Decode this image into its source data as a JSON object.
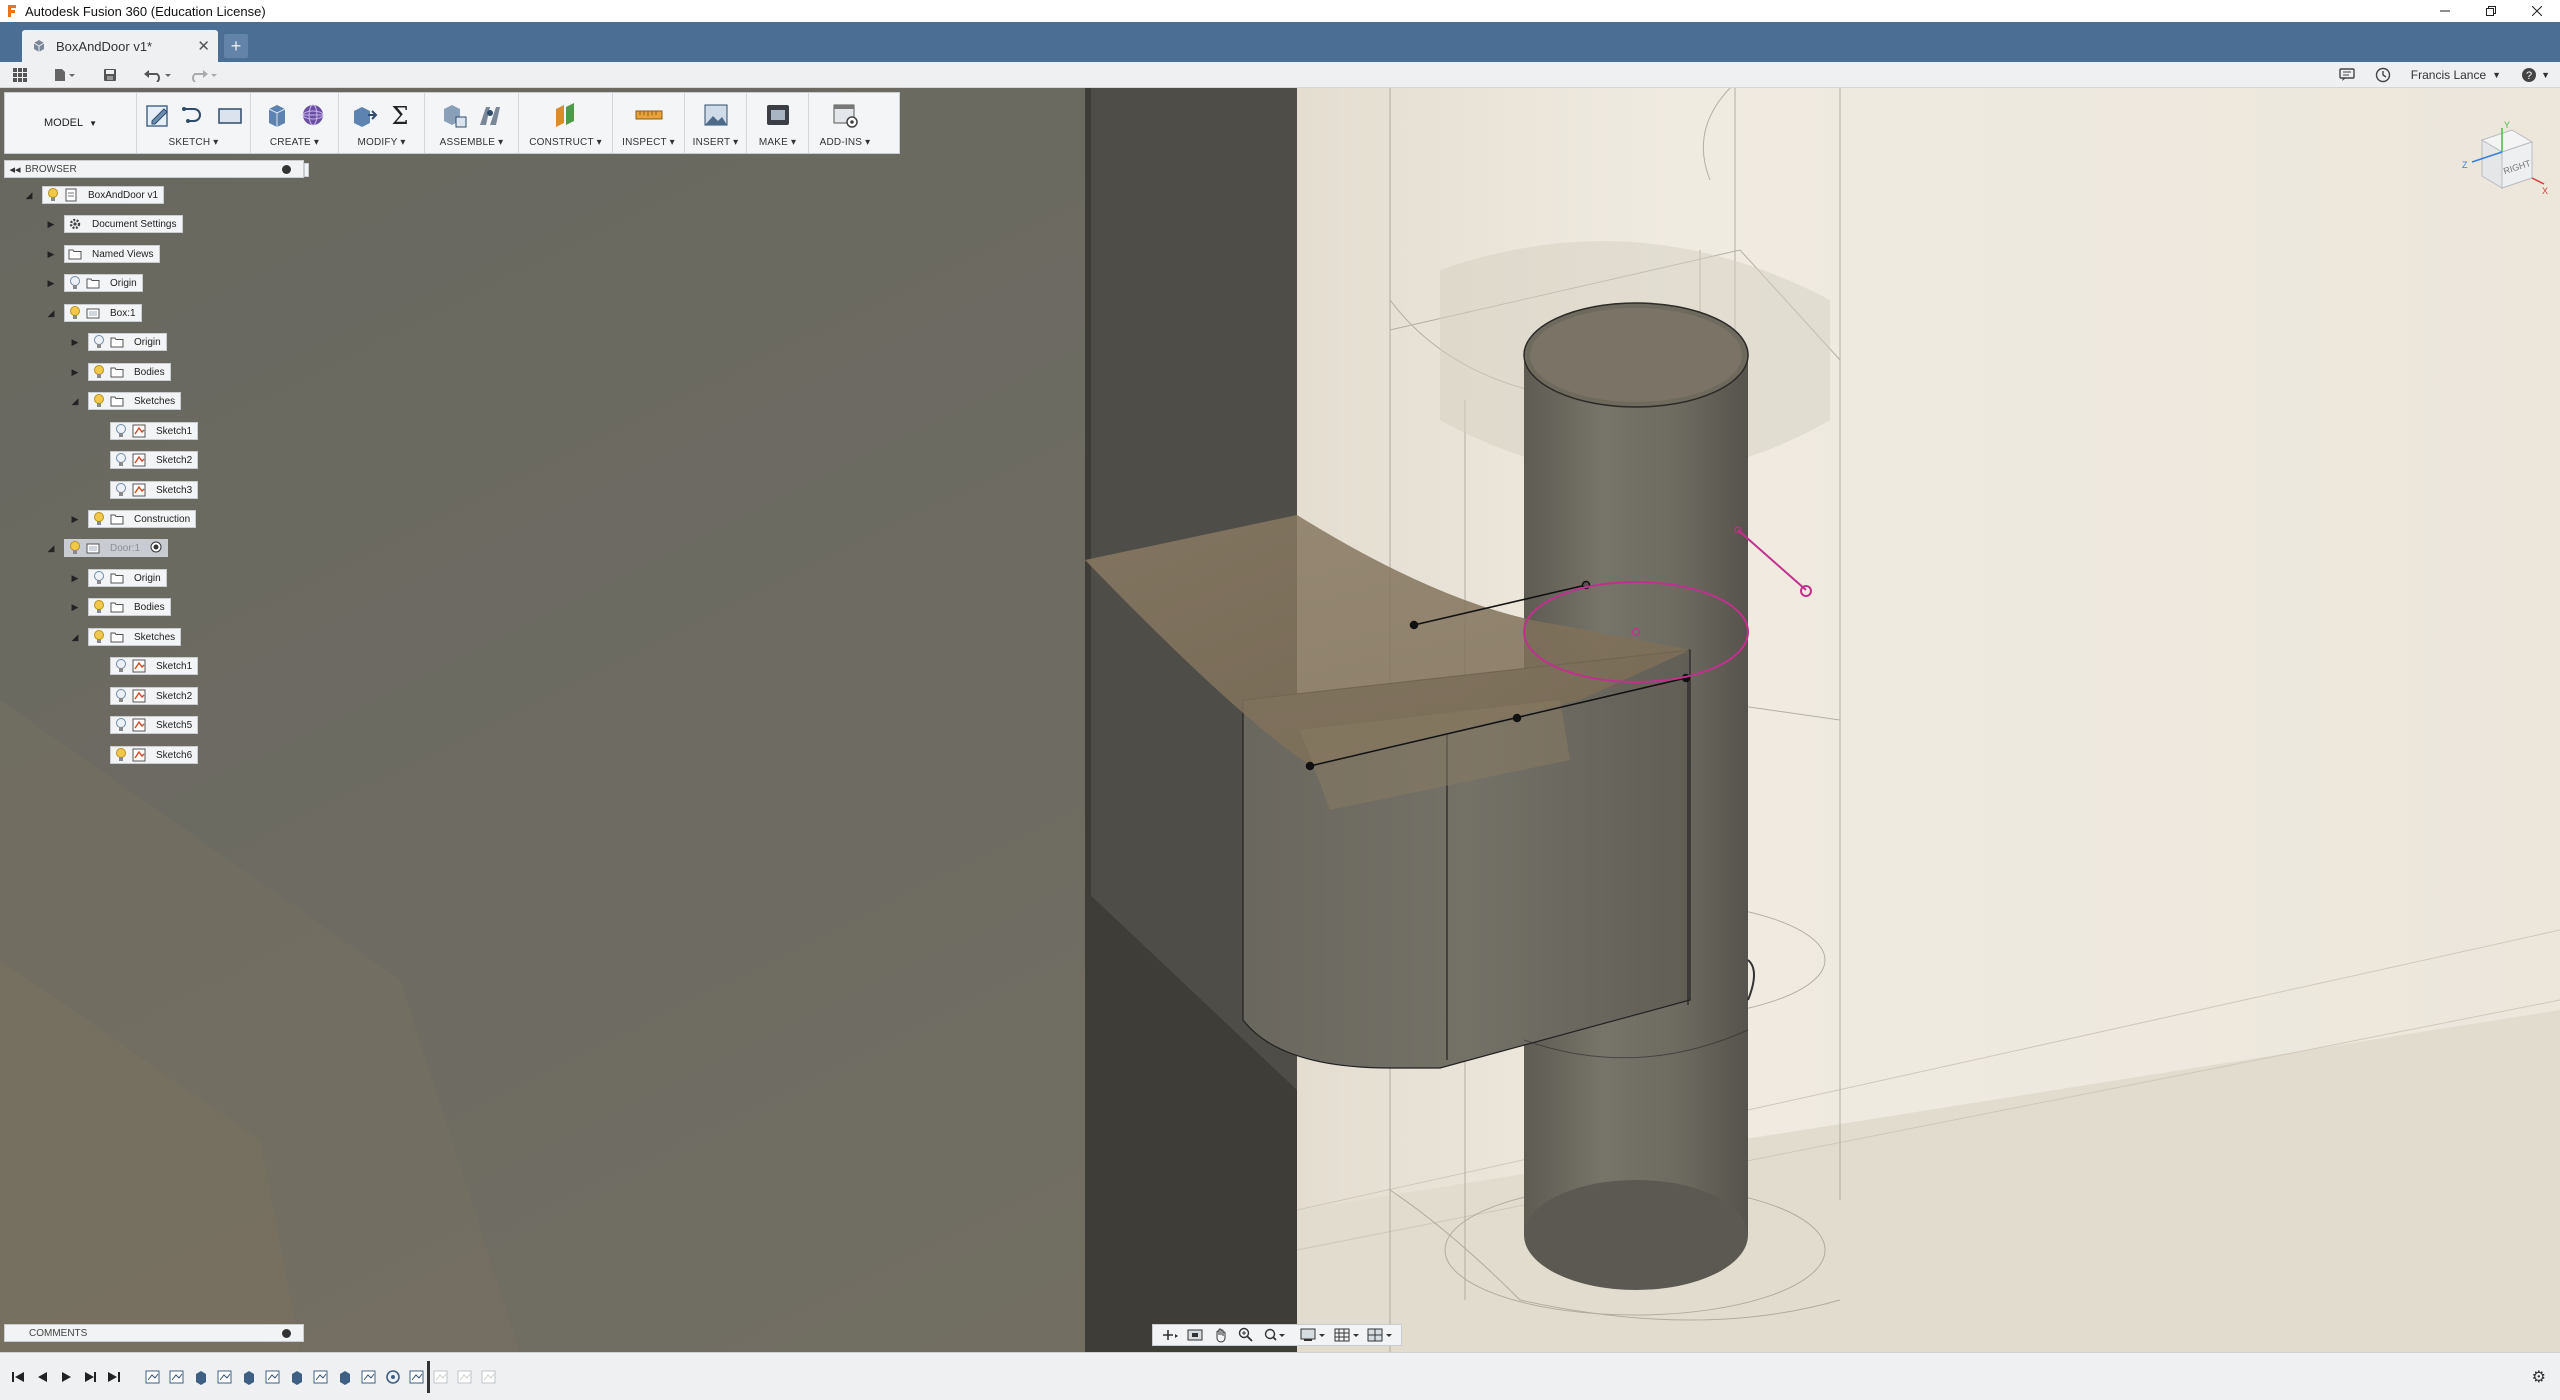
{
  "window": {
    "title": "Autodesk Fusion 360 (Education License)",
    "controls": [
      "minimize-icon",
      "restore-icon",
      "close-icon"
    ]
  },
  "tabs": {
    "active_label": "BoxAndDoor v1*",
    "new_tab_symbol": "+"
  },
  "quick_access": {
    "user_name": "Francis Lance",
    "help_symbol": "?"
  },
  "ribbon": {
    "mode": "MODEL",
    "groups": [
      {
        "label": "SKETCH",
        "icons": [
          "create-sketch-icon",
          "line-icon",
          "rectangle-icon"
        ]
      },
      {
        "label": "CREATE",
        "icons": [
          "extrude-icon",
          "form-icon"
        ]
      },
      {
        "label": "MODIFY",
        "icons": [
          "press-pull-icon",
          "parameters-icon"
        ]
      },
      {
        "label": "ASSEMBLE",
        "icons": [
          "new-component-icon",
          "joint-icon"
        ]
      },
      {
        "label": "CONSTRUCT",
        "icons": [
          "offset-plane-icon"
        ]
      },
      {
        "label": "INSPECT",
        "icons": [
          "measure-icon"
        ]
      },
      {
        "label": "INSERT",
        "icons": [
          "insert-image-icon"
        ]
      },
      {
        "label": "MAKE",
        "icons": [
          "3d-print-icon"
        ]
      },
      {
        "label": "ADD-INS",
        "icons": [
          "scripts-icon"
        ]
      }
    ],
    "dropdown_symbol": "▾"
  },
  "browser": {
    "title": "BROWSER",
    "items": [
      {
        "label": "BoxAndDoor v1",
        "level": 0,
        "toggle": "◢",
        "icons": [
          "bulb-icon",
          "document-icon"
        ]
      },
      {
        "label": "Document Settings",
        "level": 1,
        "toggle": "▶",
        "icons": [
          "gear-icon"
        ]
      },
      {
        "label": "Named Views",
        "level": 1,
        "toggle": "▶",
        "icons": [
          "folder-icon"
        ]
      },
      {
        "label": "Origin",
        "level": 1,
        "toggle": "▶",
        "icons": [
          "bulb-off-icon",
          "folder-icon"
        ]
      },
      {
        "label": "Box:1",
        "level": 1,
        "toggle": "◢",
        "icons": [
          "bulb-icon",
          "component-icon"
        ]
      },
      {
        "label": "Origin",
        "level": 2,
        "toggle": "▶",
        "icons": [
          "bulb-off-icon",
          "folder-icon"
        ]
      },
      {
        "label": "Bodies",
        "level": 2,
        "toggle": "▶",
        "icons": [
          "bulb-icon",
          "folder-icon"
        ]
      },
      {
        "label": "Sketches",
        "level": 2,
        "toggle": "◢",
        "icons": [
          "bulb-icon",
          "folder-icon"
        ]
      },
      {
        "label": "Sketch1",
        "level": 3,
        "toggle": "",
        "icons": [
          "bulb-off-icon",
          "sketch-icon"
        ]
      },
      {
        "label": "Sketch2",
        "level": 3,
        "toggle": "",
        "icons": [
          "bulb-off-icon",
          "sketch-icon"
        ]
      },
      {
        "label": "Sketch3",
        "level": 3,
        "toggle": "",
        "icons": [
          "bulb-off-icon",
          "sketch-icon"
        ]
      },
      {
        "label": "Construction",
        "level": 2,
        "toggle": "▶",
        "icons": [
          "bulb-icon",
          "folder-icon"
        ]
      },
      {
        "label": "Door:1",
        "level": 1,
        "toggle": "◢",
        "icons": [
          "bulb-icon",
          "component-icon"
        ],
        "active": true
      },
      {
        "label": "Origin",
        "level": 2,
        "toggle": "▶",
        "icons": [
          "bulb-off-icon",
          "folder-icon"
        ]
      },
      {
        "label": "Bodies",
        "level": 2,
        "toggle": "▶",
        "icons": [
          "bulb-icon",
          "folder-icon"
        ]
      },
      {
        "label": "Sketches",
        "level": 2,
        "toggle": "◢",
        "icons": [
          "bulb-icon",
          "folder-icon"
        ]
      },
      {
        "label": "Sketch1",
        "level": 3,
        "toggle": "",
        "icons": [
          "bulb-off-icon",
          "sketch-icon"
        ]
      },
      {
        "label": "Sketch2",
        "level": 3,
        "toggle": "",
        "icons": [
          "bulb-off-icon",
          "sketch-icon"
        ]
      },
      {
        "label": "Sketch5",
        "level": 3,
        "toggle": "",
        "icons": [
          "bulb-off-icon",
          "sketch-icon"
        ]
      },
      {
        "label": "Sketch6",
        "level": 3,
        "toggle": "",
        "icons": [
          "bulb-icon",
          "sketch-icon"
        ]
      }
    ]
  },
  "comments": {
    "title": "COMMENTS"
  },
  "viewcube": {
    "face_label": "RIGHT",
    "axis_x": "X",
    "axis_y": "Y",
    "axis_z": "Z"
  },
  "colors": {
    "tabbar": "#4a6e94",
    "panel": "#f2f3f4",
    "sketch_magenta": "#c2308f",
    "body_gray": "#6e6b62",
    "wall_cream": "#efe9de"
  }
}
